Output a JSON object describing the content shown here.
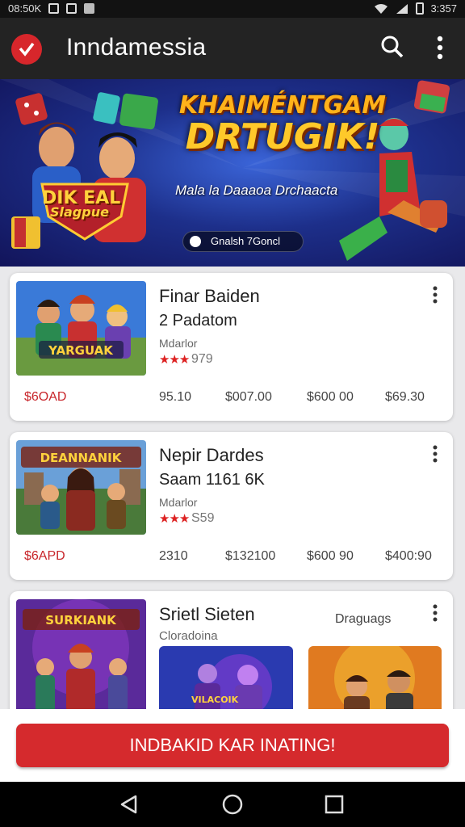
{
  "status_bar": {
    "left_text": "08:50K",
    "time": "3:357"
  },
  "app_bar": {
    "title": "Inndamessia"
  },
  "banner": {
    "title_line1": "KHAIMÉNTGAM",
    "title_line2": "DRTUGIK!",
    "subtitle": "Mala la Daaaoa Drchaacta",
    "emblem_text_line1": "DIK EAL",
    "emblem_text_line2": "Slagpue",
    "badge_label": "Gnalsh 7Goncl"
  },
  "cards": [
    {
      "title": "Finar Baiden",
      "subtitle": "2 Padatom",
      "meta": "Mdarlor",
      "stars": "★★★",
      "score": "979",
      "thumb_text": "YARGUAK",
      "prices": [
        "$6OAD",
        "95.10",
        "$007.00",
        "$600 00",
        "$69.30"
      ]
    },
    {
      "title": "Nepir Dardes",
      "subtitle": "Saam 1161 6K",
      "meta": "Mdarlor",
      "stars": "★★★",
      "score": "S59",
      "thumb_text": "DEANNANIK",
      "prices": [
        "$6APD",
        "2310",
        "$132100",
        "$600 90",
        "$400:90"
      ]
    },
    {
      "title": "Srietl Sieten",
      "subtitle": "Cloradoina",
      "tag": "Draguags",
      "thumb_text": "SURKIANK",
      "mini_thumb_text": "VILACOIK"
    }
  ],
  "cta": {
    "label": "INDBAKID KAR INATING!"
  },
  "colors": {
    "accent": "#d52a2d",
    "appbar": "#232323",
    "banner_blue": "#1d2f8a",
    "gold": "#ffc92a"
  },
  "icons": [
    "app-logo-icon",
    "search-icon",
    "more-vert-icon",
    "back-icon",
    "home-icon",
    "recents-icon"
  ]
}
